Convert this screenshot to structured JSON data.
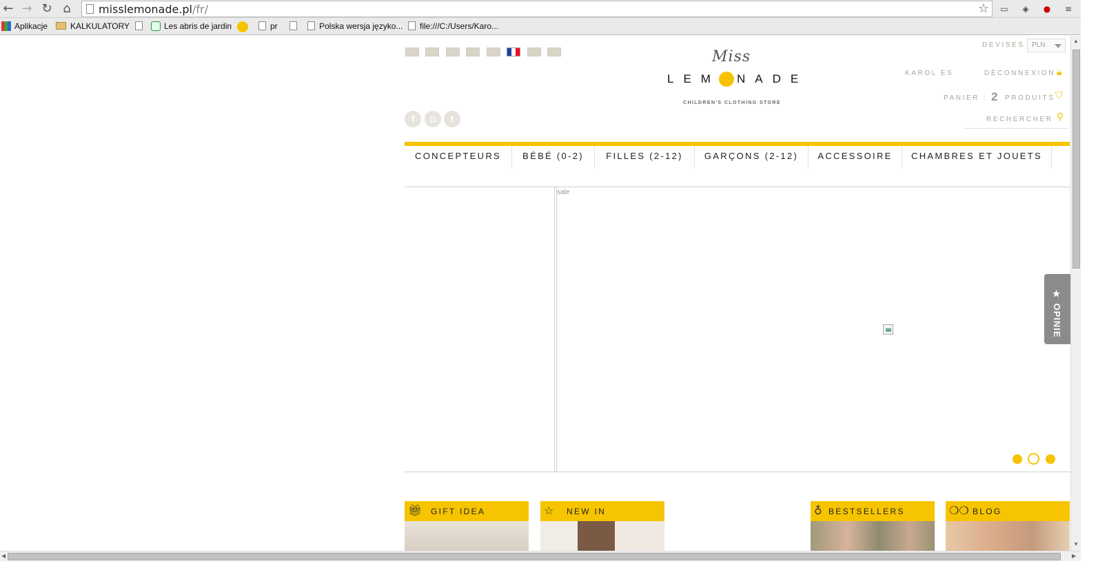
{
  "browser": {
    "url_host": "misslemonade.pl",
    "url_path": "/fr/",
    "bookmarks": [
      {
        "label": "Aplikacje",
        "icon": "apps-grid-icon"
      },
      {
        "label": "KALKULATORY",
        "icon": "folder-icon"
      },
      {
        "label": "",
        "icon": "page-icon"
      },
      {
        "label": "Les abris de jardin",
        "icon": "leaf-icon"
      },
      {
        "label": "",
        "icon": "sun-icon"
      },
      {
        "label": "pr",
        "icon": "page-icon"
      },
      {
        "label": "",
        "icon": "page-icon"
      },
      {
        "label": "Polska wersja językо...",
        "icon": "page-icon"
      },
      {
        "label": "file:///C:/Users/Karo...",
        "icon": "page-icon"
      }
    ]
  },
  "site": {
    "logo_miss": "Miss",
    "logo_lemonade_left": "LEM",
    "logo_lemonade_right": "NADE",
    "logo_sub": "CHILDREN'S CLOTHING STORE",
    "devises_label": "DEVISES",
    "currency": "PLN",
    "user_name": "KAROL ES",
    "logout": "DÉCONNEXION",
    "cart_label": "PANIER :",
    "cart_count": "2",
    "cart_unit": "PRODUITS",
    "search": "RECHERCHER",
    "nav": [
      "CONCEPTEURS",
      "BÉBÉ (0-2)",
      "FILLES (2-12)",
      "GARÇONS (2-12)",
      "ACCESSOIRE",
      "CHAMBRES ET JOUETS"
    ],
    "banner_alt": "sale",
    "opinions_tab": "★ OPINIE",
    "promos": [
      {
        "label": "GIFT IDEA",
        "icon": "gift-icon"
      },
      {
        "label": "NEW IN",
        "icon": "star-icon"
      },
      {
        "label": "BESTSELLERS",
        "icon": "bulb-icon"
      },
      {
        "label": "BLOG",
        "icon": "chat-bubbles-icon"
      }
    ]
  },
  "colors": {
    "brand_yellow": "#f5c400",
    "muted_text": "#a8a497"
  }
}
